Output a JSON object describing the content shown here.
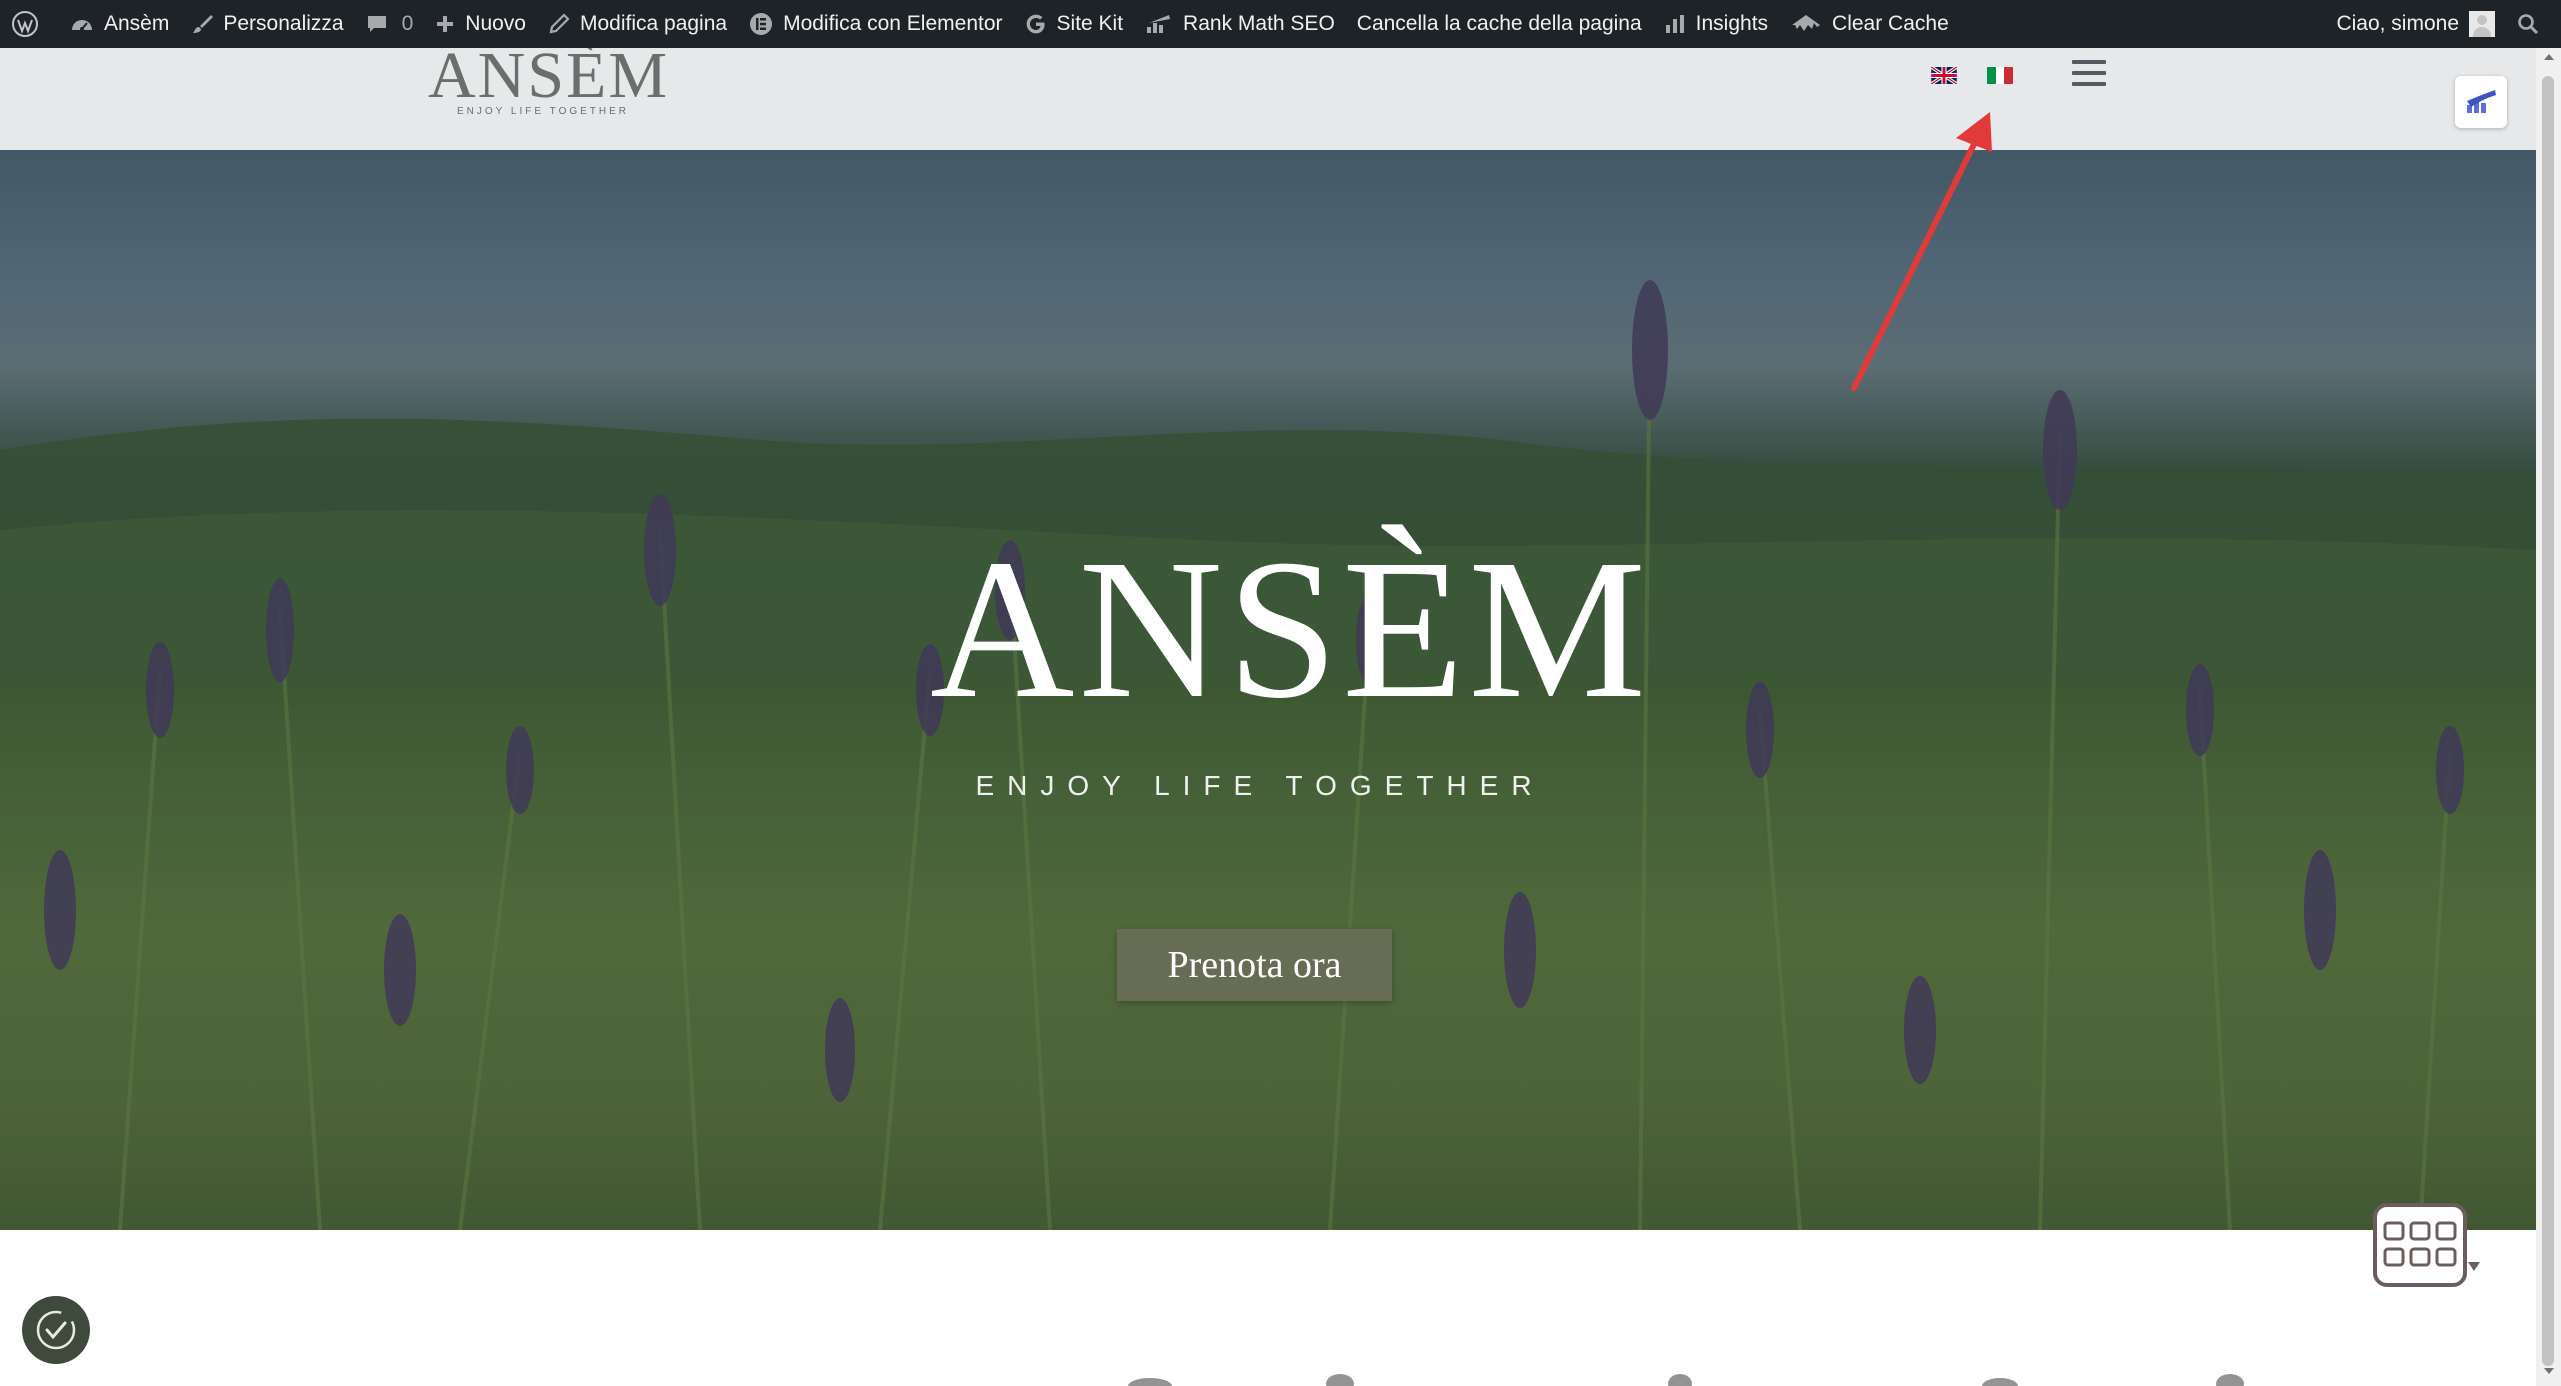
{
  "admin_bar": {
    "site_name": "Ansèm",
    "customize": "Personalizza",
    "comments_count": "0",
    "new": "Nuovo",
    "edit_page": "Modifica pagina",
    "edit_elementor": "Modifica con Elementor",
    "site_kit": "Site Kit",
    "rank_math": "Rank Math SEO",
    "clear_page_cache": "Cancella la cache della pagina",
    "insights": "Insights",
    "clear_cache": "Clear Cache",
    "greeting": "Ciao, simone"
  },
  "header": {
    "logo_word": "ANSÈM",
    "logo_tagline": "ENJOY LIFE TOGETHER",
    "languages": [
      "English",
      "Italiano"
    ]
  },
  "hero": {
    "title": "ANSÈM",
    "tagline": "ENJOY LIFE TOGETHER",
    "cta_label": "Prenota ora"
  },
  "colors": {
    "admin_bar_bg": "#1d2327",
    "header_bg": "#e6e8ea",
    "cta_bg": "#676d54",
    "annotation_arrow": "#e03a3a"
  },
  "icons": {
    "admin_bar": [
      "wordpress-logo-icon",
      "dashboard-icon",
      "brush-icon",
      "comment-icon",
      "plus-icon",
      "pencil-icon",
      "elementor-icon",
      "google-icon",
      "rank-math-icon",
      "insights-icon",
      "clear-cache-icon",
      "user-avatar-icon",
      "search-icon"
    ],
    "header": [
      "uk-flag-icon",
      "italy-flag-icon",
      "hamburger-menu-icon",
      "analytics-icon"
    ],
    "page": [
      "calendar-icon",
      "cookie-consent-icon"
    ]
  }
}
